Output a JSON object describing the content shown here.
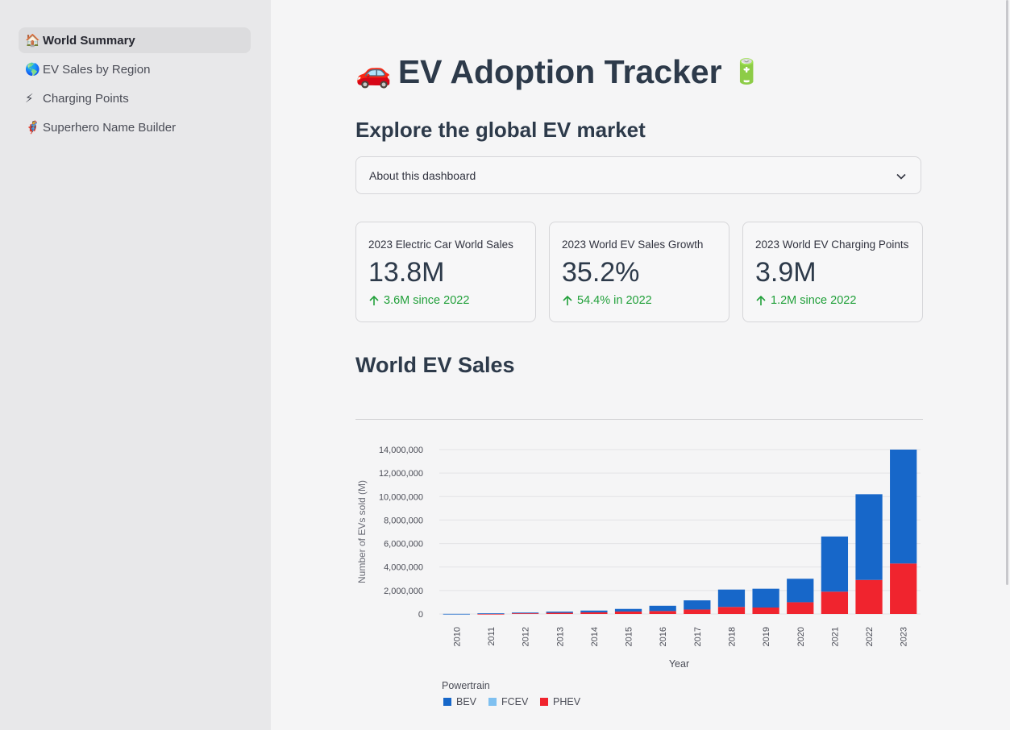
{
  "sidebar": {
    "items": [
      {
        "icon": "🏠",
        "label": "World Summary",
        "active": true
      },
      {
        "icon": "🌎",
        "label": "EV Sales by Region",
        "active": false
      },
      {
        "icon": "⚡",
        "label": "Charging Points",
        "active": false
      },
      {
        "icon": "🦸",
        "label": "Superhero Name Builder",
        "active": false
      }
    ]
  },
  "main": {
    "title": "EV Adoption Tracker",
    "title_icon_left": "🚗",
    "title_icon_right": "🔋",
    "subtitle": "Explore the global EV market",
    "expander_label": "About this dashboard",
    "metrics": [
      {
        "label": "2023 Electric Car World Sales",
        "value": "13.8M",
        "delta": "3.6M since 2022"
      },
      {
        "label": "2023 World EV Sales Growth",
        "value": "35.2%",
        "delta": "54.4% in 2022"
      },
      {
        "label": "2023 World EV Charging Points",
        "value": "3.9M",
        "delta": "1.2M since 2022"
      }
    ],
    "section_title": "World EV Sales"
  },
  "colors": {
    "BEV": "#1767c9",
    "FCEV": "#7fc0f0",
    "PHEV": "#f0242e",
    "delta_positive": "#21a03a"
  },
  "chart_data": {
    "type": "bar",
    "stacked": true,
    "xlabel": "Year",
    "ylabel": "Number of EVs sold (M)",
    "ylim": [
      0,
      14000000
    ],
    "yticks": [
      "0",
      "2,000,000",
      "4,000,000",
      "6,000,000",
      "8,000,000",
      "10,000,000",
      "12,000,000",
      "14,000,000"
    ],
    "categories": [
      "2010",
      "2011",
      "2012",
      "2013",
      "2014",
      "2015",
      "2016",
      "2017",
      "2018",
      "2019",
      "2020",
      "2021",
      "2022",
      "2023"
    ],
    "series": [
      {
        "name": "PHEV",
        "values": [
          0,
          10000,
          60000,
          100000,
          140000,
          210000,
          250000,
          380000,
          600000,
          550000,
          1000000,
          1900000,
          2900000,
          4300000
        ]
      },
      {
        "name": "FCEV",
        "values": [
          0,
          0,
          0,
          0,
          0,
          0,
          0,
          0,
          0,
          0,
          0,
          0,
          0,
          0
        ]
      },
      {
        "name": "BEV",
        "values": [
          10000,
          50000,
          60000,
          100000,
          150000,
          220000,
          450000,
          780000,
          1480000,
          1600000,
          2000000,
          4700000,
          7300000,
          9700000
        ]
      }
    ],
    "legend": {
      "title": "Powertrain",
      "position": "bottom-left",
      "entries": [
        "BEV",
        "FCEV",
        "PHEV"
      ]
    },
    "grid": true
  }
}
